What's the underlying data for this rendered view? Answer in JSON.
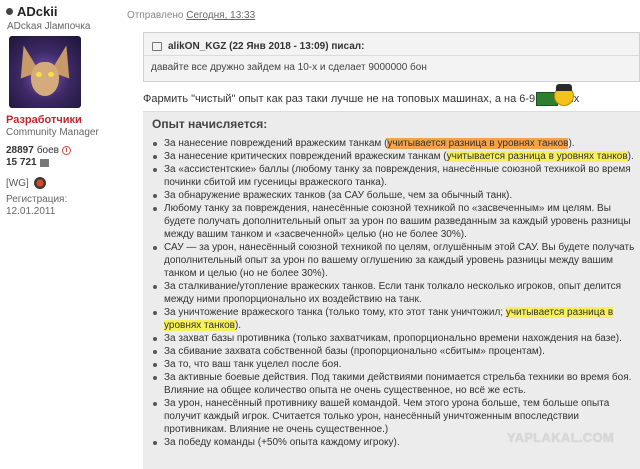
{
  "user": {
    "name": "ADckii",
    "subtitle": "ADckaя Jlaмпочка",
    "role": "Разработчики",
    "role_sub": "Community Manager",
    "battles_value": "28897",
    "battles_label": "боев",
    "rating": "15 721",
    "clan": "[WG]",
    "reg_label": "Регистрация:",
    "reg_date": "12.01.2011"
  },
  "post": {
    "sent_label": "Отправлено",
    "sent_date": "Сегодня, 13:33",
    "quote_author": "alikON_KGZ (22 Янв 2018 - 13:09) писал:",
    "quote_text": "давайте все дружно зайдем на 10-х и сделает 9000000 бон",
    "farm_text": "Фармить \"чистый\" опыт как раз таки лучше не на топовых машинах, а на 6-9 уровнях",
    "box_title": "Опыт начисляется:",
    "highlight_text": "учитывается разница в уровнях танков",
    "items": [
      {
        "pre": "За нанесение повреждений вражеским танкам (",
        "hl": "учитывается разница в уровнях танков",
        "post": ").",
        "color": "#f5a24a"
      },
      {
        "pre": "За нанесение критических повреждений вражеским танкам (",
        "hl": "учитывается разница в уровнях танков",
        "post": ").",
        "color": "#f6f05a"
      },
      {
        "pre": "За «ассистентские» баллы (любому танку за повреждения, нанесённые союзной техникой во время починки сбитой им гусеницы вражеского танка).",
        "hl": "",
        "post": ""
      },
      {
        "pre": "За обнаружение вражеских танков (за САУ больше, чем за обычный танк).",
        "hl": "",
        "post": ""
      },
      {
        "pre": "Любому танку за повреждения, нанесённые союзной техникой по «засвеченным» им целям. Вы будете получать дополнительный опыт за урон по вашим разведанным за каждый уровень разницы между вашим танком и «засвеченной» целью (но не более 30%).",
        "hl": "",
        "post": ""
      },
      {
        "pre": "САУ — за урон, нанесённый союзной техникой по целям, оглушённым этой САУ. Вы будете получать дополнительный опыт за урон по вашему оглушению за каждый уровень разницы между вашим танком и целью (но не более 30%).",
        "hl": "",
        "post": ""
      },
      {
        "pre": "За сталкивание/утопление вражеских танков. Если танк толкало несколько игроков, опыт делится между ними пропорционально их воздействию на танк.",
        "hl": "",
        "post": ""
      },
      {
        "pre": "За уничтожение вражеского танка (только тому, кто этот танк уничтожил; ",
        "hl": "учитывается разница в уровнях танков",
        "post": ").",
        "color": "#f6f05a"
      },
      {
        "pre": "За захват базы противника (только захватчикам, пропорционально времени нахождения на базе).",
        "hl": "",
        "post": ""
      },
      {
        "pre": "За сбивание захвата собственной базы (пропорционально «сбитым» процентам).",
        "hl": "",
        "post": ""
      },
      {
        "pre": "За то, что ваш танк уцелел после боя.",
        "hl": "",
        "post": ""
      },
      {
        "pre": "За активные боевые действия. Под такими действиями понимается стрельба техники во время боя. Влияние на общее количество опыта не очень существенное, но всё же есть.",
        "hl": "",
        "post": ""
      },
      {
        "pre": "За урон, нанесённый противнику вашей командой. Чем этого урона больше, тем больше опыта получит каждый игрок. Считается только урон, нанесённый уничтоженным впоследствии противникам. Влияние не очень существенное.)",
        "hl": "",
        "post": ""
      },
      {
        "pre": "За победу команды (+50% опыта каждому игроку).",
        "hl": "",
        "post": ""
      }
    ],
    "watermark": "YAPLAKAL.COM"
  },
  "icons": {
    "online_dot": "dot-icon",
    "info": "info-icon",
    "rating_flag": "flag-icon",
    "clan": "clan-emblem-icon",
    "quote": "quote-icon",
    "smile": "tank-smile-icon"
  },
  "colors": {
    "role": "#c2272d",
    "highlight_orange": "#f5a24a",
    "highlight_yellow": "#f6f05a",
    "box_bg": "#ececec"
  }
}
